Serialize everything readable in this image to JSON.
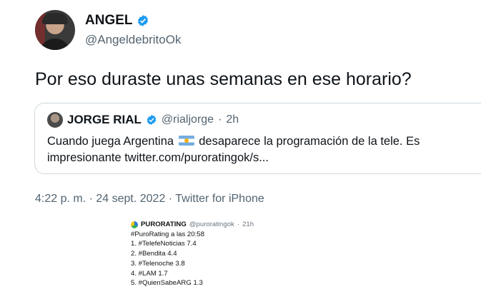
{
  "author": {
    "display_name": "ANGEL",
    "handle": "@AngeldebritoOk"
  },
  "tweet": {
    "text": "Por eso duraste unas semanas en ese horario?"
  },
  "quoted_tweet": {
    "display_name": "JORGE RIAL",
    "handle": "@rialjorge",
    "separator": "·",
    "time": "2h",
    "text_before_flag": "Cuando juega Argentina",
    "text_after_flag": "desaparece la programación de la tele. Es",
    "text_line2": "impresionante twitter.com/puroratingok/s..."
  },
  "meta": {
    "timestamp": "4:22 p. m. · 24 sept. 2022 · Twitter for iPhone"
  },
  "embedded_image": {
    "account_name": "PURORATING",
    "account_handle": "@puroratingok",
    "separator": "·",
    "time": "21h",
    "lines": [
      "#PuroRating a las 20:58",
      "1. #TelefeNoticias 7.4",
      "2. #Bendita 4.4",
      "3. #Telenoche 3.8",
      "4. #LAM 1.7",
      "5. #QuienSabeARG 1.3"
    ]
  },
  "colors": {
    "verified": "#1d9bf0",
    "secondary_text": "#536471",
    "border": "#cfd9de"
  }
}
